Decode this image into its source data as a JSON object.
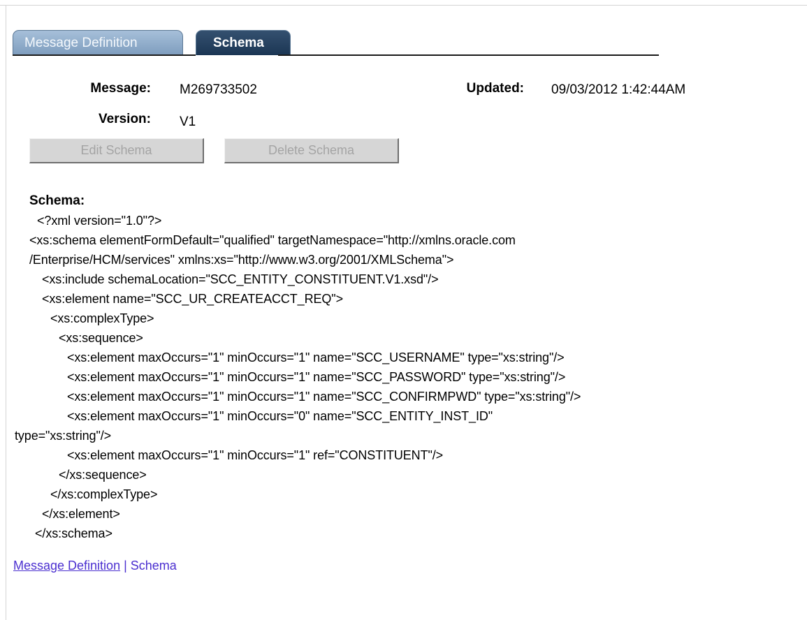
{
  "tabs": {
    "message_definition": "Message Definition",
    "schema": "Schema"
  },
  "header": {
    "message_label": "Message:",
    "message_value": "M269733502",
    "updated_label": "Updated:",
    "updated_value": "09/03/2012  1:42:44AM",
    "version_label": "Version:",
    "version_value": "V1"
  },
  "buttons": {
    "edit_schema": "Edit Schema",
    "delete_schema": "Delete Schema"
  },
  "schema": {
    "label": "Schema:",
    "lines": [
      "<?xml version=\"1.0\"?>",
      "<xs:schema elementFormDefault=\"qualified\" targetNamespace=\"http://xmlns.oracle.com",
      "/Enterprise/HCM/services\" xmlns:xs=\"http://www.w3.org/2001/XMLSchema\">",
      "<xs:include schemaLocation=\"SCC_ENTITY_CONSTITUENT.V1.xsd\"/>",
      "<xs:element name=\"SCC_UR_CREATEACCT_REQ\">",
      "<xs:complexType>",
      "<xs:sequence>",
      "<xs:element maxOccurs=\"1\" minOccurs=\"1\" name=\"SCC_USERNAME\" type=\"xs:string\"/>",
      "<xs:element maxOccurs=\"1\" minOccurs=\"1\" name=\"SCC_PASSWORD\" type=\"xs:string\"/>",
      "<xs:element maxOccurs=\"1\" minOccurs=\"1\" name=\"SCC_CONFIRMPWD\" type=\"xs:string\"/>",
      "<xs:element maxOccurs=\"1\" minOccurs=\"0\" name=\"SCC_ENTITY_INST_ID\"",
      "type=\"xs:string\"/>",
      "<xs:element maxOccurs=\"1\" minOccurs=\"1\" ref=\"CONSTITUENT\"/>",
      "</xs:sequence>",
      "</xs:complexType>",
      "</xs:element>",
      "</xs:schema>"
    ]
  },
  "footer": {
    "link_message_definition": "Message Definition",
    "separator": " | ",
    "link_schema": "Schema"
  },
  "colors": {
    "tab_active": "#25405f",
    "tab_inactive": "#8eabc9",
    "link": "#4b2fd0",
    "button_disabled_text": "#a4a4a4"
  }
}
